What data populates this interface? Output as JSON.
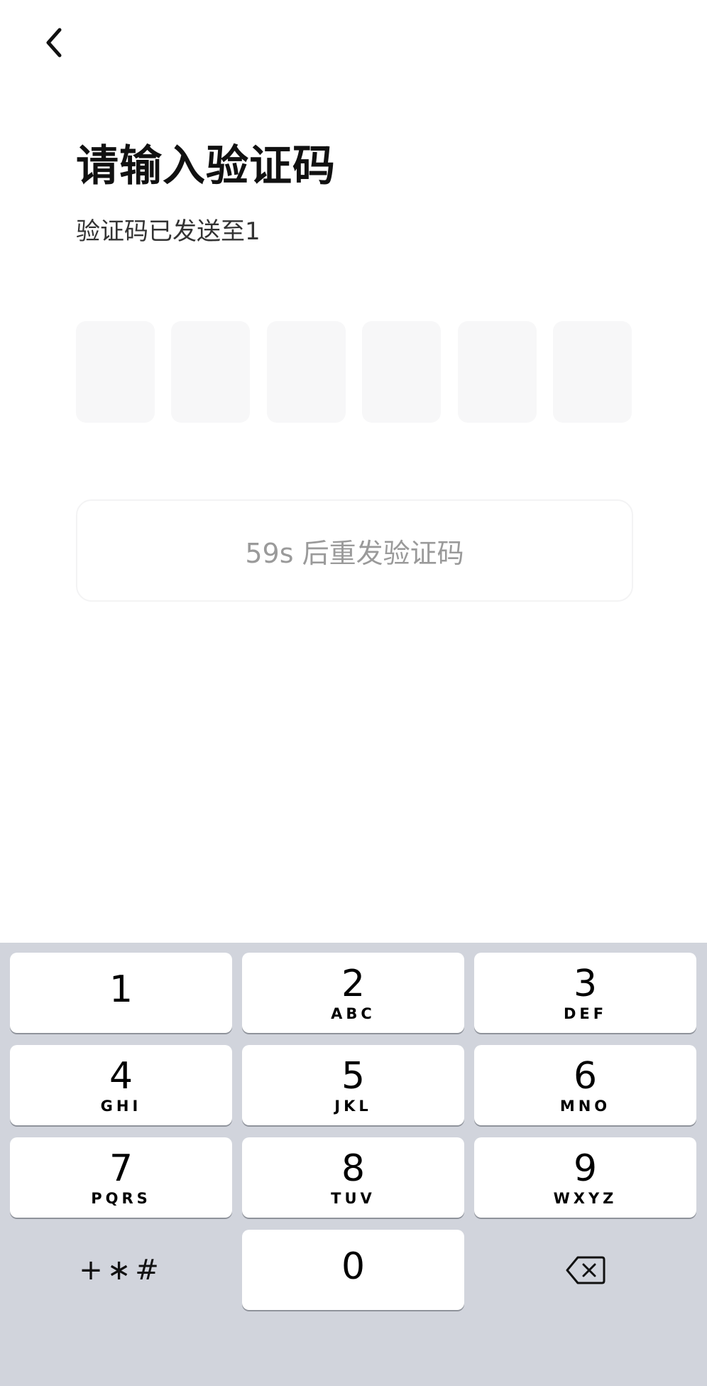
{
  "header": {
    "back_icon": "chevron-left-icon"
  },
  "main": {
    "title": "请输入验证码",
    "subtitle": "验证码已发送至1",
    "code_boxes": [
      "",
      "",
      "",
      "",
      "",
      ""
    ],
    "resend_label": "59s 后重发验证码"
  },
  "keyboard": {
    "keys": [
      {
        "digit": "1",
        "letters": ""
      },
      {
        "digit": "2",
        "letters": "ABC"
      },
      {
        "digit": "3",
        "letters": "DEF"
      },
      {
        "digit": "4",
        "letters": "GHI"
      },
      {
        "digit": "5",
        "letters": "JKL"
      },
      {
        "digit": "6",
        "letters": "MNO"
      },
      {
        "digit": "7",
        "letters": "PQRS"
      },
      {
        "digit": "8",
        "letters": "TUV"
      },
      {
        "digit": "9",
        "letters": "WXYZ"
      },
      {
        "digit": "0",
        "letters": ""
      }
    ],
    "symbols_label": "+∗#",
    "delete_icon": "backspace-icon"
  },
  "colors": {
    "keyboard_bg": "#d1d4dc",
    "code_box_bg": "#f7f7f8",
    "resend_text": "#9a9a9a"
  }
}
